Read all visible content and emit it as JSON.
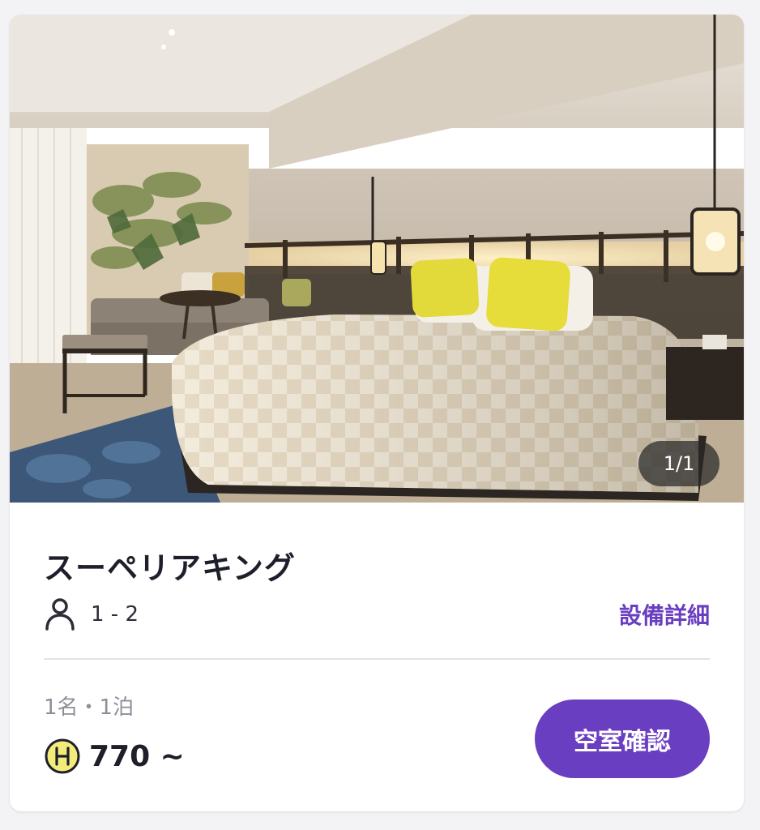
{
  "room": {
    "name": "スーペリアキング",
    "image_alt": "Superior King room photo",
    "image_counter": "1/1",
    "capacity": "1 - 2",
    "details_link": "設備詳細",
    "stay_summary": "1名・1泊",
    "price": "770 ~",
    "price_currency_icon": "H-coin-icon",
    "cta_label": "空室確認"
  },
  "colors": {
    "accent": "#6a3ec0",
    "title": "#1f1f2b",
    "muted": "#8e8e98",
    "coin_fill": "#f4ec7a"
  }
}
